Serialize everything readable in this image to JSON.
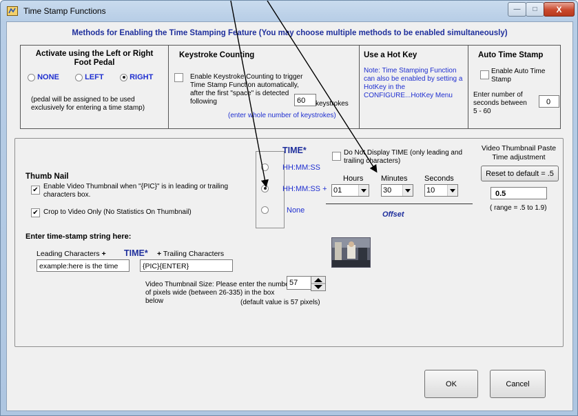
{
  "window": {
    "title": "Time Stamp Functions",
    "close_glyph": "X",
    "minimize_glyph": "—",
    "maximize_glyph": "□"
  },
  "header": "Methods for Enabling the Time Stamping Feature (You may choose multiple methods to be enabled simultaneously)",
  "pedal": {
    "heading": "Activate using the Left or Right Foot Pedal",
    "options": [
      "NONE",
      "LEFT",
      "RIGHT"
    ],
    "selected": "RIGHT",
    "note": "(pedal will be assigned to be used exclusively for entering a time stamp)"
  },
  "keystroke": {
    "heading": "Keystroke Counting",
    "checkbox_label": "Enable Keystroke Counting to trigger Time Stamp Function automatically, after the first \"space\" is detected following",
    "count_value": "60",
    "unit": "keystrokes",
    "hint": "(enter whole number of keystrokes)"
  },
  "hotkey": {
    "heading": "Use a Hot Key",
    "note": "Note: Time Stamping Function can also be enabled by setting a HotKey in the CONFIGURE...HotKey Menu"
  },
  "auto": {
    "heading": "Auto Time Stamp",
    "checkbox_label": "Enable Auto Time Stamp",
    "seconds_label": "Enter number of seconds between 5 - 60",
    "seconds_value": "0"
  },
  "time": {
    "heading": "TIME*",
    "no_display_label": "Do Not Display TIME (only leading and trailing characters)",
    "options": [
      "HH:MM:SS",
      "HH:MM:SS",
      "None"
    ],
    "plus": "+",
    "selected_index": 1,
    "hours_label": "Hours",
    "hours_value": "01",
    "minutes_label": "Minutes",
    "minutes_value": "30",
    "seconds_label": "Seconds",
    "seconds_value": "10",
    "offset_label": "Offset"
  },
  "thumbnail": {
    "heading": "Thumb Nail",
    "enable_label": "Enable Video Thumbnail when \"{PIC}\" is in leading or trailing characters box.",
    "crop_label": "Crop to Video Only (No Statistics On Thumbnail)",
    "paste_title": "Video Thumbnail Paste Time adjustment",
    "reset_button": "Reset to default = .5",
    "adjust_value": "0.5",
    "range": "( range = .5 to 1.9)",
    "size_label": "Video Thumbnail Size:  Please enter the number of pixels wide (between 26-335) in the box below",
    "size_value": "57",
    "size_default": "(default value is 57 pixels)"
  },
  "stamp": {
    "heading": "Enter time-stamp string here:",
    "leading_label": "Leading Characters",
    "plus": "+",
    "time_label": "TIME*",
    "trailing_label": "Trailing Characters",
    "leading_value": "example:here is the time",
    "trailing_value": "{PIC}{ENTER}"
  },
  "buttons": {
    "ok": "OK",
    "cancel": "Cancel"
  }
}
